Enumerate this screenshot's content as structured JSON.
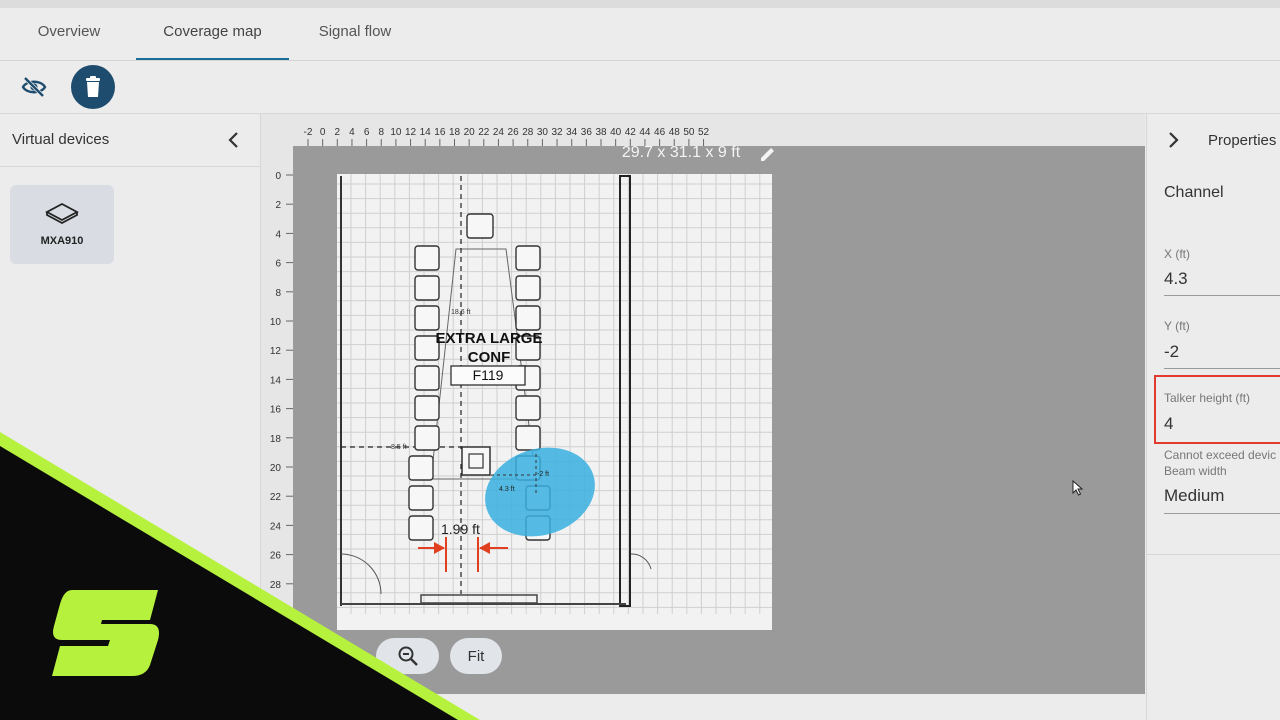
{
  "tabs": [
    {
      "label": "Overview"
    },
    {
      "label": "Coverage map"
    },
    {
      "label": "Signal flow"
    }
  ],
  "toolbar": {
    "visibility_icon": "eye-off-icon",
    "delete_icon": "trash-icon"
  },
  "left_panel": {
    "title": "Virtual devices",
    "devices": [
      {
        "name": "MXA910",
        "icon": "ceiling-array-icon"
      }
    ]
  },
  "canvas": {
    "dimensions_label": "29.7 x 31.1 x 9 ft",
    "ruler_x": [
      "-2",
      "0",
      "2",
      "4",
      "6",
      "8",
      "10",
      "12",
      "14",
      "16",
      "18",
      "20",
      "22",
      "24",
      "26",
      "28",
      "30",
      "32",
      "34",
      "36",
      "38",
      "40",
      "42",
      "44",
      "46",
      "48",
      "50",
      "52"
    ],
    "ruler_y": [
      "0",
      "2",
      "4",
      "6",
      "8",
      "10",
      "12",
      "14",
      "16",
      "18",
      "20",
      "22",
      "24",
      "26",
      "28"
    ],
    "room_label_line1": "EXTRA LARGE",
    "room_label_line2": "CONF",
    "room_id": "F119",
    "measure_label": "1.99 ft",
    "small_dim_1": "18.6 ft",
    "small_dim_2": "8.5 ft",
    "small_dim_3": "4.3 ft",
    "small_dim_4": "-2 ft"
  },
  "zoom": {
    "fit_label": "Fit"
  },
  "properties": {
    "title": "Properties",
    "section": "Channel",
    "x_label": "X (ft)",
    "x_value": "4.3",
    "y_label": "Y (ft)",
    "y_value": "-2",
    "talker_label": "Talker height (ft)",
    "talker_value": "4",
    "helper_text": "Cannot exceed devic",
    "beam_label": "Beam width",
    "beam_value": "Medium"
  },
  "colors": {
    "accent": "#1b6e98",
    "highlight": "#e13a2e",
    "coverage": "#3ab0e0",
    "brand_green": "#b6f23d"
  }
}
